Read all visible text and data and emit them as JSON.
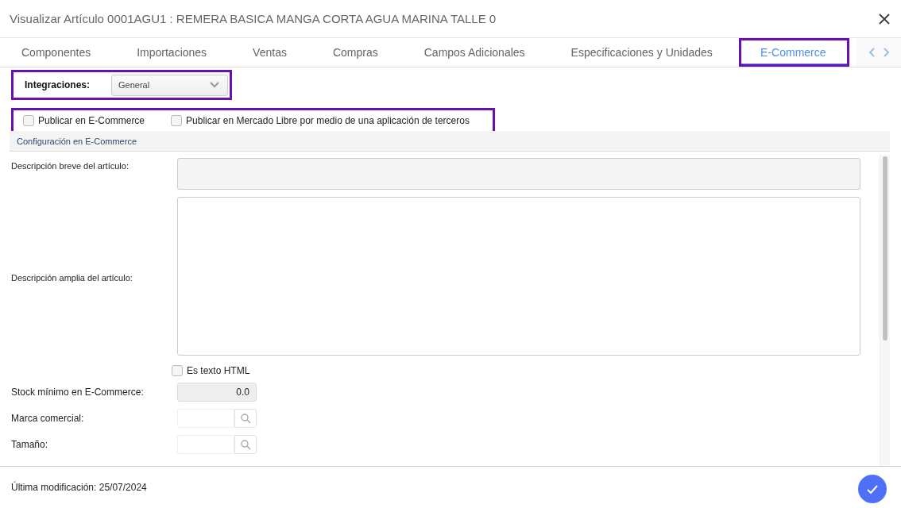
{
  "window": {
    "title": "Visualizar Artículo 0001AGU1 : REMERA BASICA MANGA CORTA AGUA MARINA TALLE 0"
  },
  "tabs": [
    {
      "label": "Componentes",
      "selected": false
    },
    {
      "label": "Importaciones",
      "selected": false
    },
    {
      "label": "Ventas",
      "selected": false
    },
    {
      "label": "Compras",
      "selected": false
    },
    {
      "label": "Campos Adicionales",
      "selected": false
    },
    {
      "label": "Especificaciones y Unidades",
      "selected": false
    },
    {
      "label": "E-Commerce",
      "selected": true
    }
  ],
  "integrations": {
    "label": "Integraciones:",
    "value": "General"
  },
  "publish_options": [
    {
      "label": "Publicar en E-Commerce",
      "checked": false
    },
    {
      "label": "Publicar en Mercado Libre por medio de una aplicación de terceros",
      "checked": false
    }
  ],
  "section_title": "Configuración en E-Commerce",
  "fields": [
    {
      "kind": "short-text",
      "label": "Descripción breve del artículo:"
    },
    {
      "kind": "long-text",
      "label": "Descripción amplia del artículo:"
    },
    {
      "kind": "checkbox",
      "label": "Es texto HTML",
      "checked": false
    },
    {
      "kind": "number",
      "label": "Stock mínimo en E-Commerce:",
      "value": "0.0"
    },
    {
      "kind": "lookup",
      "label": "Marca comercial:"
    },
    {
      "kind": "lookup",
      "label": "Tamaño:"
    }
  ],
  "footer": {
    "last_modified": "Última modificación: 25/07/2024"
  }
}
